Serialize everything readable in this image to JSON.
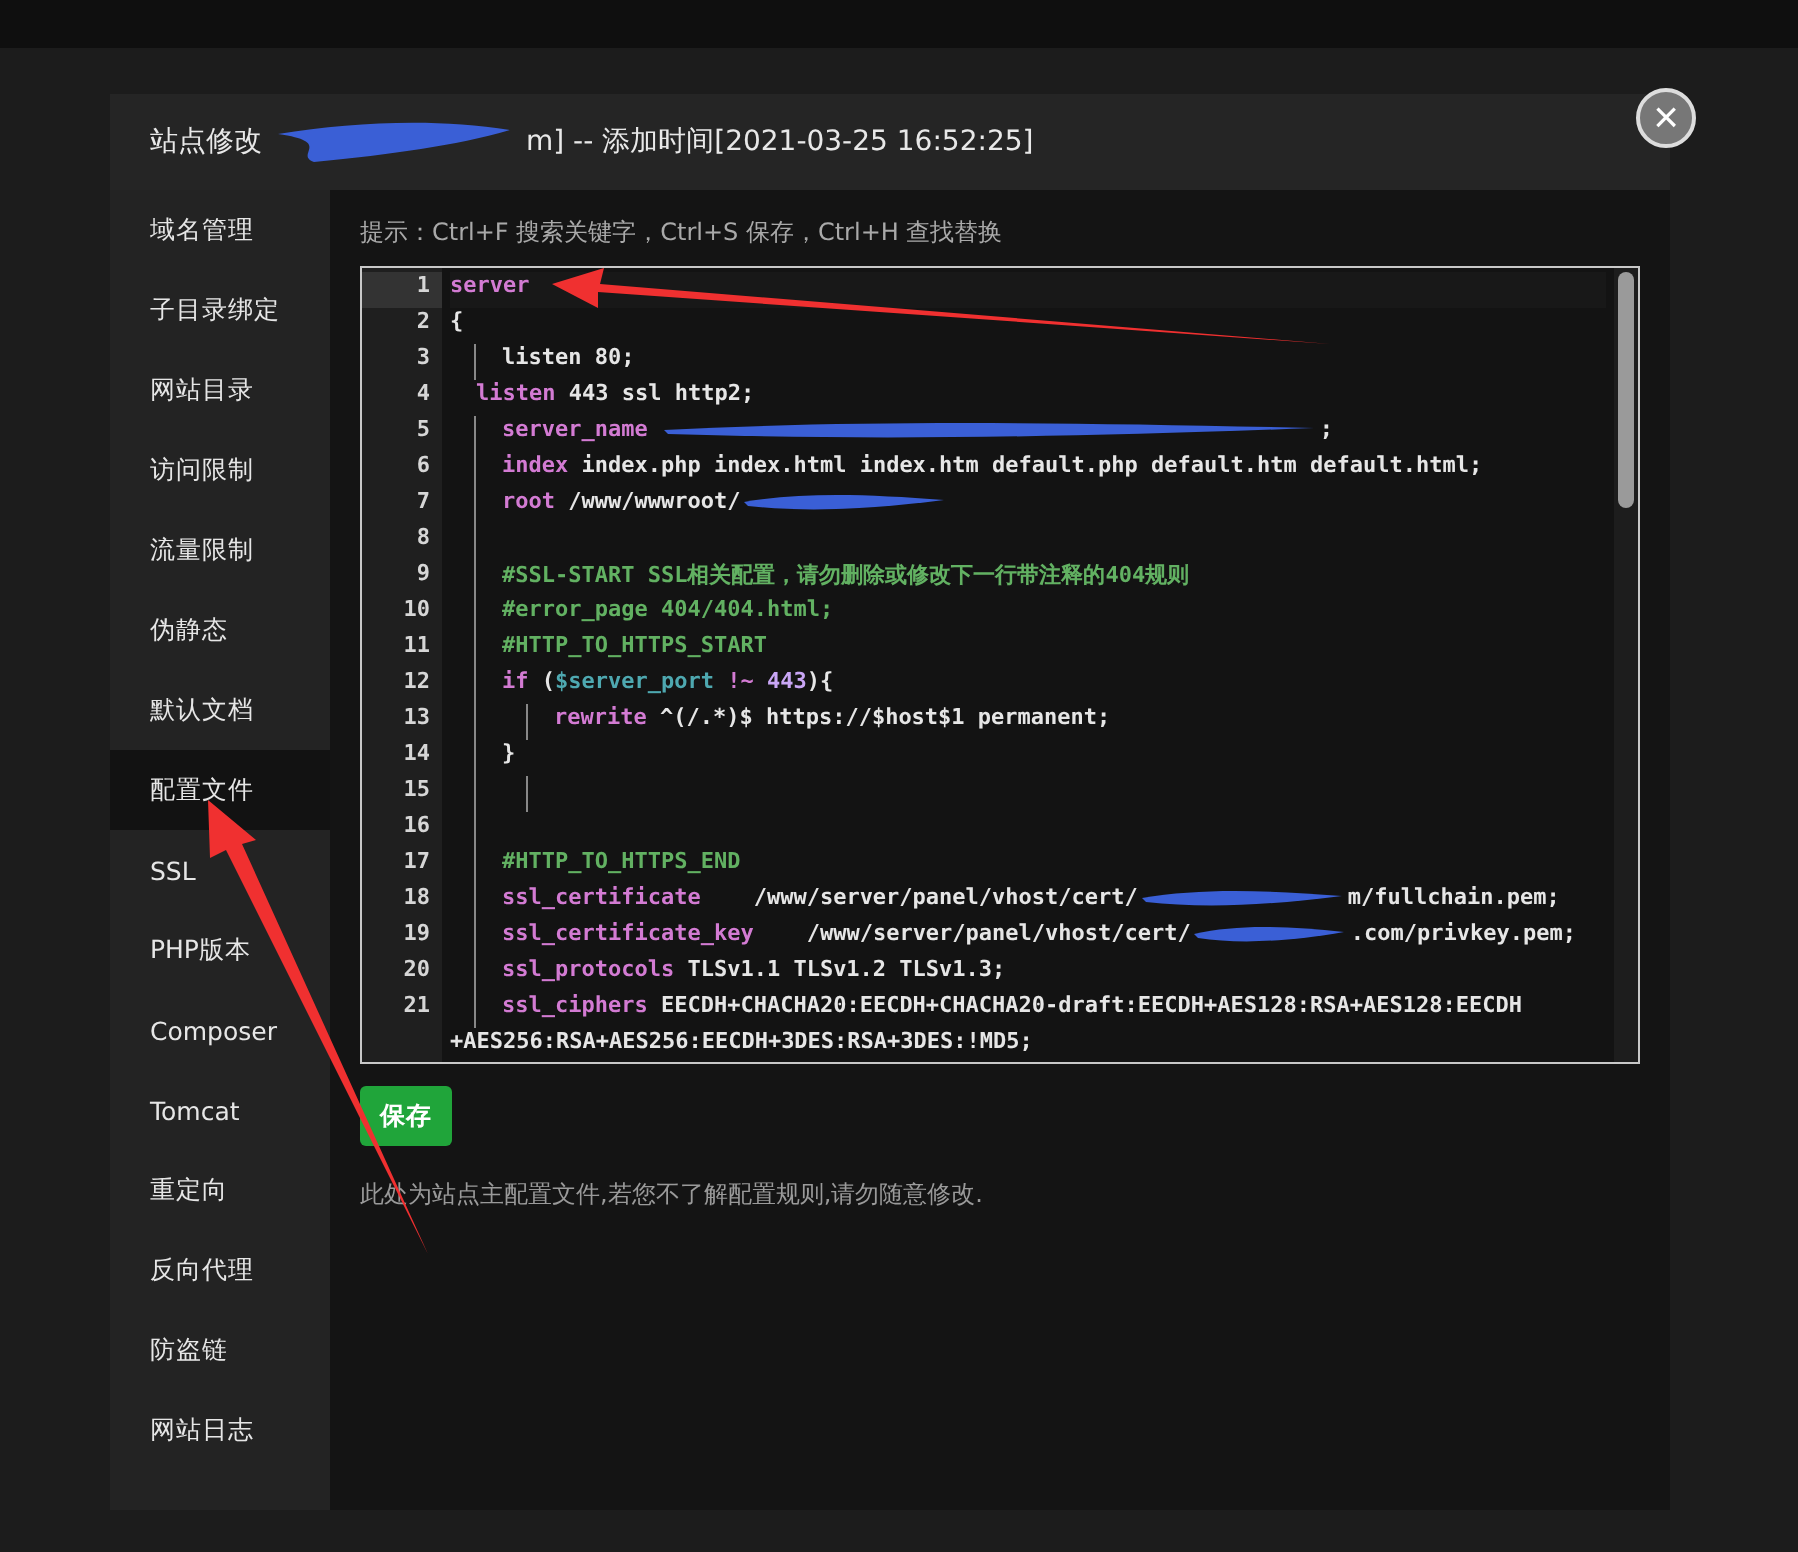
{
  "dialog": {
    "title_prefix": "站点修改",
    "title_suffix": "m] -- 添加时间[2021-03-25 16:52:25]",
    "close": "×"
  },
  "sidebar": {
    "items": [
      {
        "label": "域名管理",
        "selected": false
      },
      {
        "label": "子目录绑定",
        "selected": false
      },
      {
        "label": "网站目录",
        "selected": false
      },
      {
        "label": "访问限制",
        "selected": false
      },
      {
        "label": "流量限制",
        "selected": false
      },
      {
        "label": "伪静态",
        "selected": false
      },
      {
        "label": "默认文档",
        "selected": false
      },
      {
        "label": "配置文件",
        "selected": true
      },
      {
        "label": "SSL",
        "selected": false
      },
      {
        "label": "PHP版本",
        "selected": false
      },
      {
        "label": "Composer",
        "selected": false
      },
      {
        "label": "Tomcat",
        "selected": false
      },
      {
        "label": "重定向",
        "selected": false
      },
      {
        "label": "反向代理",
        "selected": false
      },
      {
        "label": "防盗链",
        "selected": false
      },
      {
        "label": "网站日志",
        "selected": false
      }
    ]
  },
  "hint": "提示：Ctrl+F 搜索关键字，Ctrl+S 保存，Ctrl+H 查找替换",
  "editor": {
    "lines": [
      {
        "number": "1",
        "current": true,
        "segments": [
          {
            "kind": "keyword",
            "text": "server"
          }
        ]
      },
      {
        "number": "2",
        "current": false,
        "segments": [
          {
            "kind": "plain",
            "text": "{"
          }
        ]
      },
      {
        "number": "3",
        "current": false,
        "segments": [
          {
            "kind": "guide"
          },
          {
            "kind": "plain",
            "text": "listen 80;"
          }
        ]
      },
      {
        "number": "4",
        "current": false,
        "segments": [
          {
            "kind": "space"
          },
          {
            "kind": "keyword",
            "text": "listen"
          },
          {
            "kind": "plain",
            "text": " 443 ssl http2;"
          }
        ]
      },
      {
        "number": "5",
        "current": false,
        "segments": [
          {
            "kind": "guide"
          },
          {
            "kind": "keyword",
            "text": "server_name"
          },
          {
            "kind": "longredaction"
          },
          {
            "kind": "plain",
            "text": ";"
          }
        ]
      },
      {
        "number": "6",
        "current": false,
        "segments": [
          {
            "kind": "guide"
          },
          {
            "kind": "keyword",
            "text": "index"
          },
          {
            "kind": "plain",
            "text": " index.php index.html index.htm default.php default.htm default.html;"
          }
        ]
      },
      {
        "number": "7",
        "current": false,
        "segments": [
          {
            "kind": "guide"
          },
          {
            "kind": "keyword",
            "text": "root"
          },
          {
            "kind": "plain",
            "text": " /www/wwwroot/"
          },
          {
            "kind": "redaction"
          }
        ]
      },
      {
        "number": "8",
        "current": false,
        "segments": [
          {
            "kind": "guide"
          }
        ]
      },
      {
        "number": "9",
        "current": false,
        "segments": [
          {
            "kind": "guide"
          },
          {
            "kind": "comment",
            "text": "#SSL-START SSL相关配置，请勿删除或修改下一行带注释的404规则"
          }
        ]
      },
      {
        "number": "10",
        "current": false,
        "segments": [
          {
            "kind": "guide"
          },
          {
            "kind": "comment",
            "text": "#error_page 404/404.html;"
          }
        ]
      },
      {
        "number": "11",
        "current": false,
        "segments": [
          {
            "kind": "guide"
          },
          {
            "kind": "comment",
            "text": "#HTTP_TO_HTTPS_START"
          }
        ]
      },
      {
        "number": "12",
        "current": false,
        "segments": [
          {
            "kind": "guide"
          },
          {
            "kind": "keyword",
            "text": "if"
          },
          {
            "kind": "plain",
            "text": " ("
          },
          {
            "kind": "variable",
            "text": "$server_port"
          },
          {
            "kind": "keyword",
            "text": " !~ "
          },
          {
            "kind": "number",
            "text": "443"
          },
          {
            "kind": "plain",
            "text": "){"
          }
        ]
      },
      {
        "number": "13",
        "current": false,
        "segments": [
          {
            "kind": "guide"
          },
          {
            "kind": "guide"
          },
          {
            "kind": "keyword",
            "text": "rewrite"
          },
          {
            "kind": "plain",
            "text": " ^(/.*)$ https://$host$1 permanent;"
          }
        ]
      },
      {
        "number": "14",
        "current": false,
        "segments": [
          {
            "kind": "guide"
          },
          {
            "kind": "plain",
            "text": "}"
          }
        ]
      },
      {
        "number": "15",
        "current": false,
        "segments": [
          {
            "kind": "guide"
          },
          {
            "kind": "guide"
          }
        ]
      },
      {
        "number": "16",
        "current": false,
        "segments": [
          {
            "kind": "guide"
          }
        ]
      },
      {
        "number": "17",
        "current": false,
        "segments": [
          {
            "kind": "guide"
          },
          {
            "kind": "comment",
            "text": "#HTTP_TO_HTTPS_END"
          }
        ]
      },
      {
        "number": "18",
        "current": false,
        "segments": [
          {
            "kind": "guide"
          },
          {
            "kind": "keyword",
            "text": "ssl_certificate"
          },
          {
            "kind": "plain",
            "text": "    /www/server/panel/vhost/cert/"
          },
          {
            "kind": "redaction"
          },
          {
            "kind": "plain",
            "text": "m/fullchain.pem;"
          }
        ]
      },
      {
        "number": "19",
        "current": false,
        "segments": [
          {
            "kind": "guide"
          },
          {
            "kind": "keyword",
            "text": "ssl_certificate_key"
          },
          {
            "kind": "plain",
            "text": "    /www/server/panel/vhost/cert/"
          },
          {
            "kind": "shortredaction"
          },
          {
            "kind": "plain",
            "text": ".com/privkey.pem;"
          }
        ]
      },
      {
        "number": "20",
        "current": false,
        "segments": [
          {
            "kind": "guide"
          },
          {
            "kind": "keyword",
            "text": "ssl_protocols"
          },
          {
            "kind": "plain",
            "text": " TLSv1.1 TLSv1.2 TLSv1.3;"
          }
        ]
      },
      {
        "number": "21",
        "current": false,
        "segments": [
          {
            "kind": "guide"
          },
          {
            "kind": "keyword",
            "text": "ssl_ciphers"
          },
          {
            "kind": "plain",
            "text": " EECDH+CHACHA20:EECDH+CHACHA20-draft:EECDH+AES128:RSA+AES128:EECDH +AES256:RSA+AES256:EECDH+3DES:RSA+3DES:!MD5;"
          }
        ]
      }
    ]
  },
  "save_button": "保存",
  "note": "此处为站点主配置文件,若您不了解配置规则,请勿随意修改."
}
